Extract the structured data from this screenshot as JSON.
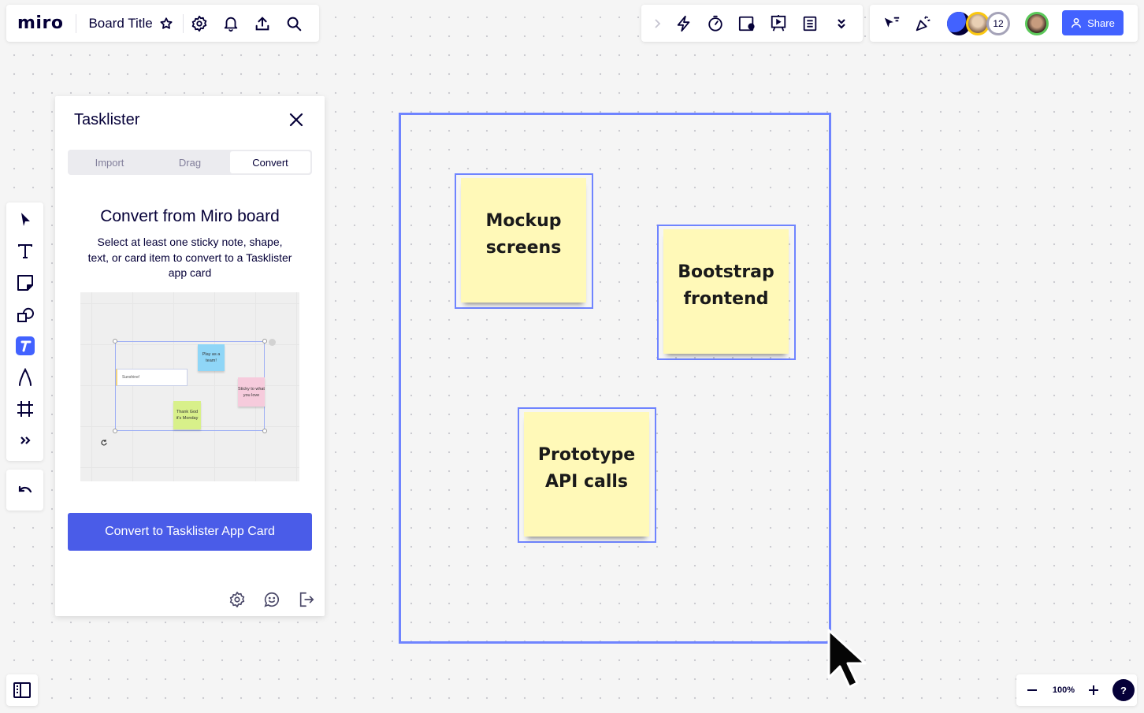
{
  "topbar": {
    "logo": "miro",
    "board_title": "Board Title",
    "icons": [
      "star-icon",
      "settings-icon",
      "notifications-icon",
      "export-icon",
      "search-icon"
    ]
  },
  "toolbar_center": {
    "icons": [
      "expand-chevron-icon",
      "lightning-icon",
      "timer-icon",
      "video-card-icon",
      "presentation-icon",
      "notes-icon",
      "more-chevrons-icon"
    ]
  },
  "toolbar_right": {
    "icons": [
      "reactions-cursor-icon",
      "celebrate-icon"
    ],
    "collaborators_extra_count": "12",
    "share_label": "Share",
    "brand_color": "#4262ff"
  },
  "left_toolbar": {
    "tools": [
      "select",
      "text",
      "sticky-note",
      "shapes",
      "tasklister-app",
      "pen",
      "frame",
      "more-tools"
    ],
    "undo": "undo"
  },
  "tasklister": {
    "title": "Tasklister",
    "tabs": [
      {
        "label": "Import",
        "active": false
      },
      {
        "label": "Drag",
        "active": false
      },
      {
        "label": "Convert",
        "active": true
      }
    ],
    "heading": "Convert from Miro board",
    "description": "Select at least one sticky note, shape, text, or card item to convert to a Tasklister app card",
    "preview": {
      "text_item": "Sunshine!",
      "stickies": [
        {
          "text": "Play as a team!",
          "color": "#8fd6f7"
        },
        {
          "text": "Sticky to what you love",
          "color": "#f6cbdc"
        },
        {
          "text": "Thank God it's Monday",
          "color": "#d8f08a"
        }
      ]
    },
    "convert_button": "Convert to Tasklister App Card",
    "button_color": "#4a5ce8",
    "footer_icons": [
      "settings-icon",
      "feedback-icon",
      "sign-out-icon"
    ]
  },
  "canvas": {
    "frame_color": "#6f84ff",
    "stickies": [
      {
        "line1": "Mockup",
        "line2": "screens",
        "color": "#fff9b8"
      },
      {
        "line1": "Bootstrap",
        "line2": "frontend",
        "color": "#fff9b8"
      },
      {
        "line1": "Prototype",
        "line2": "API calls",
        "color": "#fff9b8"
      }
    ]
  },
  "zoom_controls": {
    "zoom_level": "100%",
    "help": "?"
  }
}
